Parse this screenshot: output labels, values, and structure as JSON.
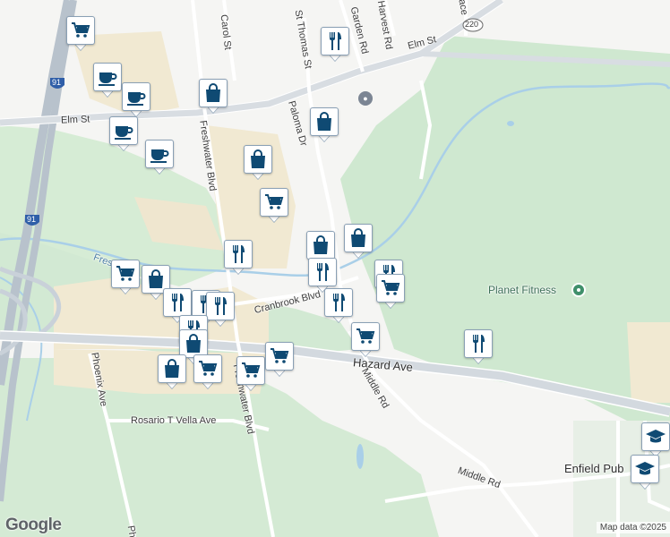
{
  "map": {
    "roads": {
      "elm_st_west": "Elm St",
      "elm_st_east": "Elm St",
      "carol_st": "Carol St",
      "st_thomas_st": "St Thomas St",
      "paloma_dr": "Paloma Dr",
      "harvest_rd": "Harvest Rd",
      "garden_rd": "Garden Rd",
      "freshwater_blvd_north": "Freshwater Blvd",
      "freshwater_blvd_south": "Freshwater Blvd",
      "cranbrook_blvd": "Cranbrook Blvd",
      "hazard_ave": "Hazard Ave",
      "middle_rd_north": "Middle Rd",
      "middle_rd_south": "Middle Rd",
      "phoenix_ave": "Phoenix Ave",
      "rosario_t_vella_ave": "Rosario T Vella Ave",
      "route_220": "220",
      "i91_north": "91",
      "i91_south": "91",
      "fresh_partial": "Fres",
      "place_partial": "ace",
      "phoenix_partial": "Ph"
    },
    "places": {
      "planet_fitness": "Planet Fitness",
      "enfield_public": "Enfield Pub"
    },
    "branding": {
      "google": "Google",
      "attribution": "Map data ©2025"
    },
    "marker_types": {
      "shopping-cart": "grocery",
      "coffee-cup": "cafe",
      "shopping-bag": "store",
      "fork-knife": "restaurant",
      "graduation-cap": "school"
    },
    "colors": {
      "marker_icon": "#0f4a73",
      "green_area": "#cfe8d0",
      "commercial": "#f1e9d2",
      "water": "#a9cfe8",
      "highway": "#b8c2cc"
    }
  }
}
